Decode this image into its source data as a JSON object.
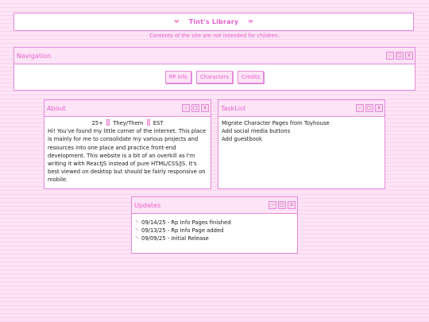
{
  "header": {
    "title": "Tint's Library",
    "disclaimer": "Contents of the site are not intended for children."
  },
  "navigation": {
    "title": "Navigation",
    "links": [
      "RP Info",
      "Characters",
      "Credits"
    ]
  },
  "about": {
    "title": "About",
    "tags": [
      "25+",
      "They/Them",
      "EST"
    ],
    "text": "Hi! You've found my little corner of the internet. This place is mainly for me to consolidate my various projects and resources into one place and practice front-end development. This website is a bit of an overkill as I'm writing it with ReactJS instead of pure HTML/CSS/JS. It's best viewed on desktop but should be fairly responsive on mobile."
  },
  "tasklist": {
    "title": "TaskList",
    "items": [
      "Migrate Character Pages from Toyhouse",
      "Add social media buttons",
      "Add guestbook"
    ]
  },
  "updates": {
    "title": "Updates",
    "items": [
      "09/14/25 - Rp Info Pages finished",
      "09/13/25 - Rp Info Page added",
      "09/09/25 - Initial Release"
    ]
  },
  "window_controls": [
    "-",
    "□",
    "x"
  ],
  "colors": {
    "accent": "#e55fce",
    "border": "#e58ad8",
    "panel": "#fde4f6"
  }
}
